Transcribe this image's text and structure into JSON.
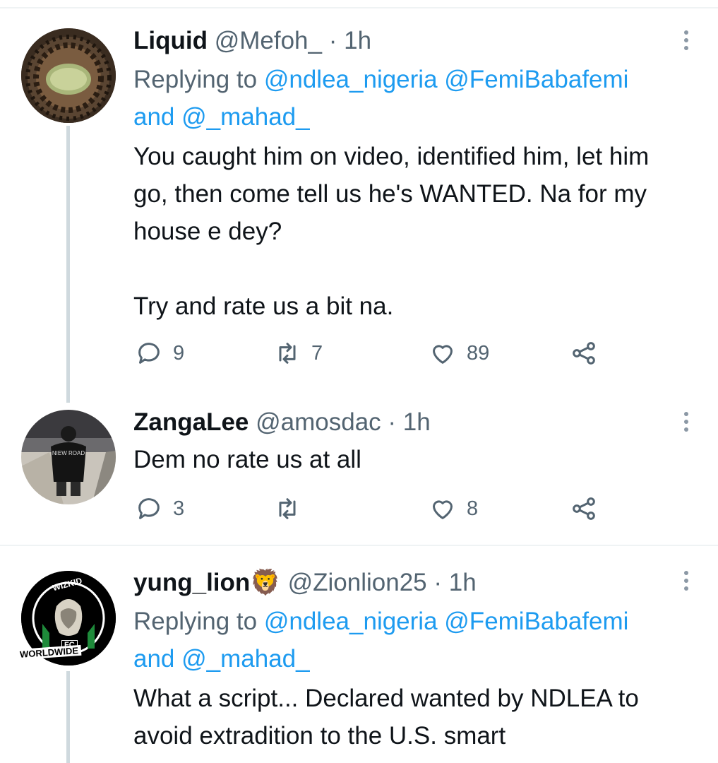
{
  "tweets": [
    {
      "name": "Liquid",
      "handle": "@Mefoh_",
      "time": "· 1h",
      "replying_prefix": "Replying to",
      "mention1": "@ndlea_nigeria",
      "mention2": "@FemiBabafemi",
      "and": "and",
      "mention3": "@_mahad_",
      "text": "You caught him on video, identified him, let him go, then come tell us he's WANTED. Na for my house e dey?\n\nTry and rate us a bit na.",
      "replies": "9",
      "retweets": "7",
      "likes": "89"
    },
    {
      "name": "ZangaLee",
      "handle": "@amosdac",
      "time": "· 1h",
      "text": "Dem no rate us at all",
      "replies": "3",
      "retweets": "",
      "likes": "8"
    },
    {
      "name": "yung_lion",
      "name_emoji": "🦁",
      "handle": "@Zionlion25",
      "time": "· 1h",
      "replying_prefix": "Replying to",
      "mention1": "@ndlea_nigeria",
      "mention2": "@FemiBabafemi",
      "and": "and",
      "mention3": "@_mahad_",
      "text": "What a script... Declared wanted by NDLEA to avoid extradition to the U.S. smart",
      "avatar_logo": {
        "top": "WIZKID",
        "mid": "FC",
        "bottom": "WORLDWIDE"
      }
    }
  ],
  "colors": {
    "link": "#1d9bf0",
    "muted": "#536471",
    "text": "#0f1419",
    "divider": "#eff3f4"
  },
  "icons": [
    "reply-icon",
    "retweet-icon",
    "like-icon",
    "share-icon",
    "more-icon"
  ]
}
